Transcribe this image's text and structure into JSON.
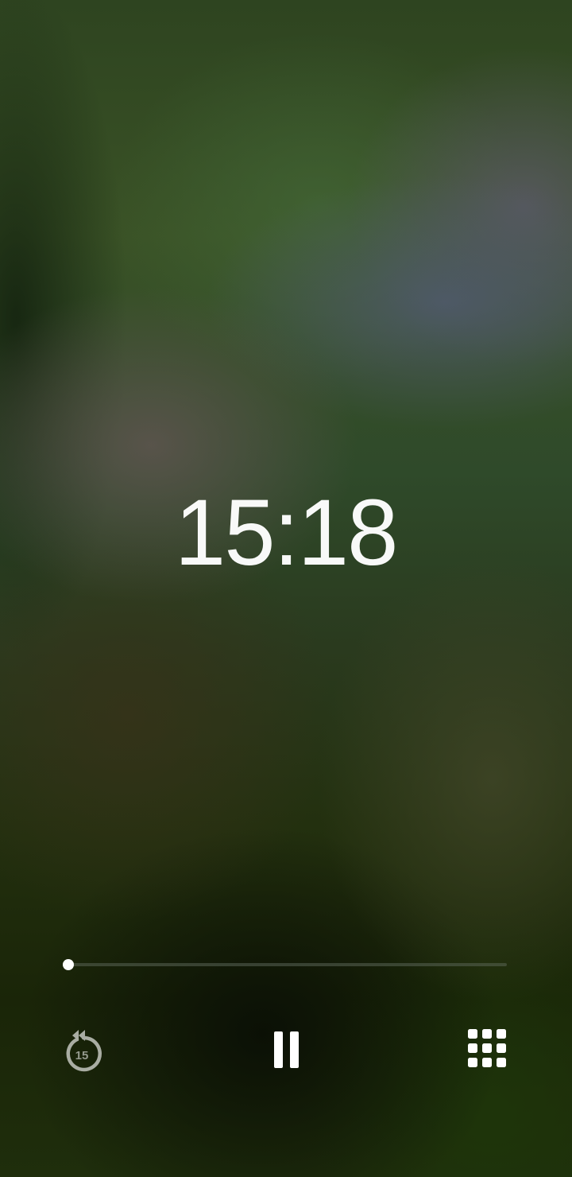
{
  "clock": {
    "time": "15:18"
  },
  "playback": {
    "progress_fraction": 0.0
  },
  "controls": {
    "rewind": {
      "icon": "rewind-15-icon",
      "seconds_label": "15"
    },
    "pause": {
      "icon": "pause-icon"
    },
    "menu": {
      "icon": "grid-menu-icon"
    }
  },
  "colors": {
    "foreground": "#ffffff",
    "rewind_icon": "#a9ada3"
  }
}
